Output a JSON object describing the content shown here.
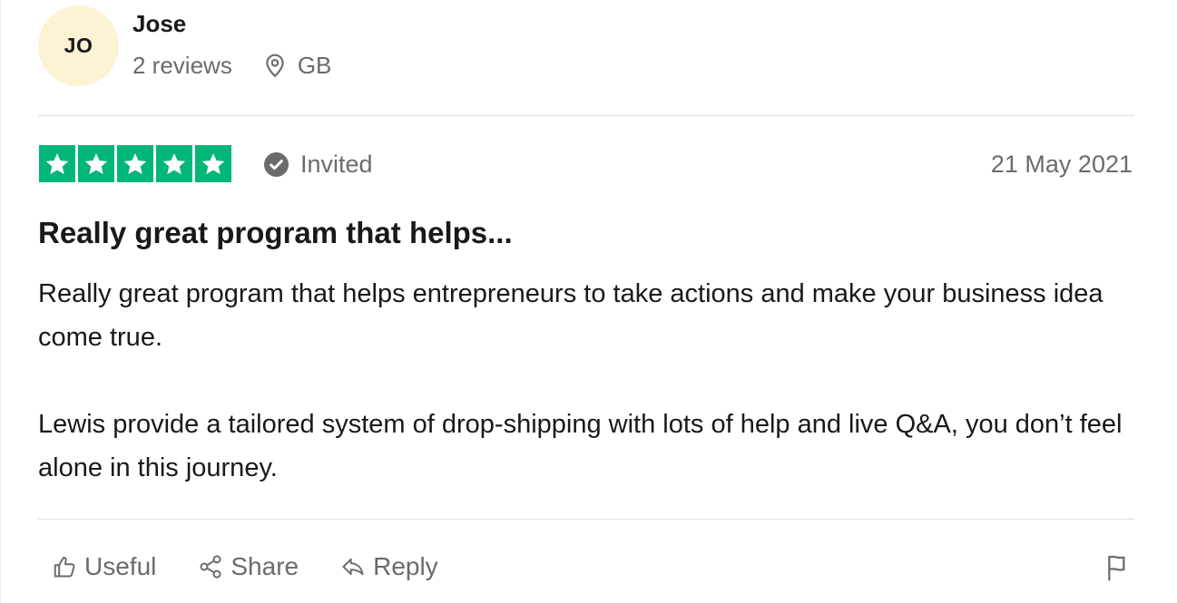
{
  "consumer": {
    "initials": "JO",
    "name": "Jose",
    "reviews_count": "2 reviews",
    "location": "GB",
    "avatar_color": "#fbf3d4"
  },
  "rating": {
    "stars": 5,
    "star_color": "#00b67a",
    "status": "Invited",
    "date": "21 May 2021"
  },
  "review": {
    "title": "Really great program that helps...",
    "paragraphs": [
      "Really great program that helps entrepreneurs to take actions and make your business idea come true.",
      "Lewis provide a tailored system of drop-shipping with lots of help and live Q&A, you don’t feel alone in this journey."
    ]
  },
  "actions": {
    "useful": "Useful",
    "share": "Share",
    "reply": "Reply"
  },
  "icons": {
    "location": "map-pin-icon",
    "verified": "check-circle-icon",
    "useful": "thumbs-up-icon",
    "share": "share-icon",
    "reply": "reply-icon",
    "report": "flag-icon"
  }
}
